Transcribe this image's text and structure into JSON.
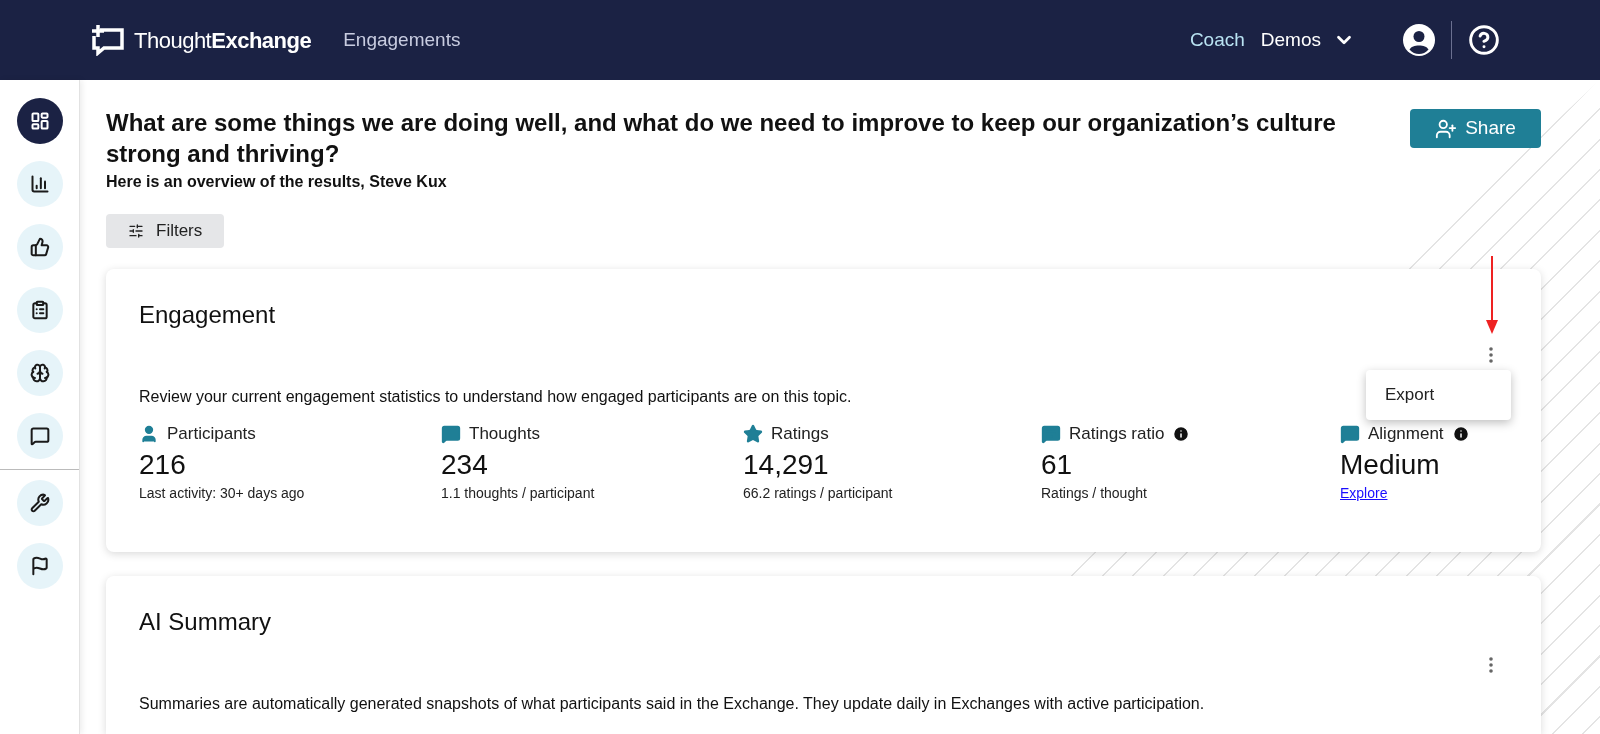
{
  "header": {
    "logo": "Thought**Exchange**",
    "nav": "Engagements",
    "coach": "Coach",
    "org": "Demos"
  },
  "sidebar": {
    "items": [
      {
        "selected": true
      },
      {
        "selected": false
      },
      {
        "selected": false
      },
      {
        "selected": false
      },
      {
        "selected": false
      },
      {
        "selected": false
      }
    ],
    "tools": [
      {
        "selected": false
      },
      {
        "selected": false
      }
    ]
  },
  "page": {
    "title": "What are some things we are doing well, and what do we need to improve to keep our organization’s culture strong and thriving?",
    "subtitle": "Here is an overview of the results, Steve Kux",
    "share": "Share",
    "filters": "Filters"
  },
  "engagement": {
    "title": "Engagement",
    "description": "Review your current engagement statistics to understand how engaged participants are on this topic.",
    "menu": {
      "open": true,
      "items": [
        "Export"
      ]
    },
    "stats": [
      {
        "label": "Participants",
        "value": "216",
        "note": "Last activity: 30+ days ago",
        "info": false
      },
      {
        "label": "Thoughts",
        "value": "234",
        "note": "1.1 thoughts / participant",
        "info": false
      },
      {
        "label": "Ratings",
        "value": "14,291",
        "note": "66.2 ratings / participant",
        "info": false
      },
      {
        "label": "Ratings ratio",
        "value": "61",
        "note": "Ratings / thought",
        "info": true
      },
      {
        "label": "Alignment",
        "value": "Medium",
        "link": "Explore",
        "info": true
      }
    ]
  },
  "ai_summary": {
    "title": "AI Summary",
    "description": "Summaries are automatically generated snapshots of what participants said in the Exchange. They update daily in Exchanges with active participation."
  }
}
